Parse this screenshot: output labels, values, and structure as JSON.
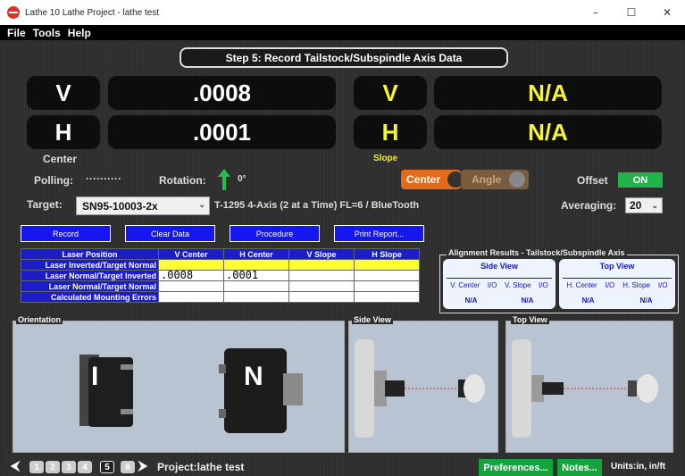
{
  "window": {
    "title": "Lathe 10 Lathe Project - lathe test",
    "minimize": "–",
    "maximize": "☐",
    "close": "✕"
  },
  "menu": [
    "File",
    "Tools",
    "Help"
  ],
  "step_title": "Step 5: Record Tailstock/Subspindle Axis Data",
  "readouts": {
    "v_label": "V",
    "v_center": ".0008",
    "h_label": "H",
    "h_center": ".0001",
    "v_slope_label": "V",
    "v_slope": "N/A",
    "h_slope_label": "H",
    "h_slope": "N/A",
    "center_caption": "Center",
    "slope_caption": "Slope"
  },
  "status": {
    "polling_label": "Polling:",
    "polling_value": "··········",
    "rotation_label": "Rotation:",
    "rotation_value": "0°",
    "center_btn": "Center",
    "angle_btn": "Angle",
    "offset_label": "Offset",
    "offset_value": "ON"
  },
  "target": {
    "label": "Target:",
    "value": "SN95-10003-2x",
    "description": "T-1295 4-Axis (2 at a Time) FL=6 / BlueTooth",
    "averaging_label": "Averaging:",
    "averaging_value": "20"
  },
  "buttons": {
    "record": "Record",
    "clear_data": "Clear Data",
    "procedure": "Procedure",
    "print_report": "Print Report..."
  },
  "table": {
    "headers": [
      "Laser Position",
      "V Center",
      "H Center",
      "V Slope",
      "H Slope"
    ],
    "rows": [
      {
        "label": "Laser Inverted/Target Normal",
        "values": [
          "",
          "",
          "",
          ""
        ]
      },
      {
        "label": "Laser Normal/Target Inverted",
        "values": [
          ".0008",
          ".0001",
          "",
          ""
        ]
      },
      {
        "label": "Laser Normal/Target Normal",
        "values": [
          "",
          "",
          "",
          ""
        ]
      },
      {
        "label": "Calculated Mounting Errors",
        "values": [
          "",
          "",
          "",
          ""
        ]
      }
    ]
  },
  "alignment": {
    "title": "Alignment Results - Tailstock/Subspindle Axis",
    "side_view": {
      "title": "Side View",
      "cols": [
        "V. Center",
        "I/O",
        "V. Slope",
        "I/O"
      ],
      "vals": [
        "N/A",
        "N/A"
      ]
    },
    "top_view": {
      "title": "Top View",
      "cols": [
        "H. Center",
        "I/O",
        "H. Slope",
        "I/O"
      ],
      "vals": [
        "N/A",
        "N/A"
      ]
    }
  },
  "panels": {
    "orientation": "Orientation",
    "orientation_i": "I",
    "orientation_n": "N",
    "side_view": "Side View",
    "top_view": "Top View"
  },
  "footer": {
    "steps": [
      "1",
      "2",
      "3",
      "4",
      "5",
      "6"
    ],
    "project": "Project:lathe test",
    "preferences": "Preferences...",
    "notes": "Notes...",
    "units": "Units:in, in/ft"
  }
}
